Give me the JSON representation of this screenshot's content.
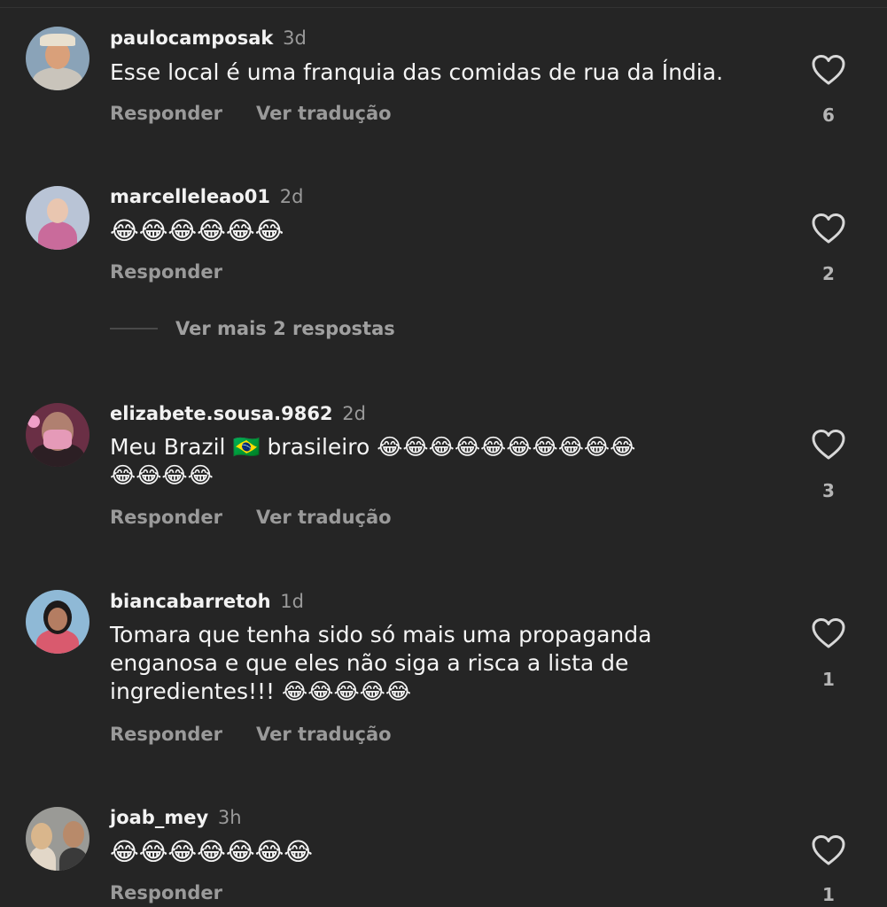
{
  "actions": {
    "reply": "Responder",
    "translate": "Ver tradução"
  },
  "comments": [
    {
      "username": "paulocamposak",
      "time": "3d",
      "text": "Esse local é uma franquia das comidas de rua da Índia.",
      "likes": "6"
    },
    {
      "username": "marcelleleao01",
      "time": "2d",
      "text": "😂😂😂😂😂😂",
      "likes": "2"
    },
    {
      "username": "elizabete.sousa.9862",
      "time": "2d",
      "text_line1": "Meu Brazil 🇧🇷 brasileiro 😂😂😂😂😂😂😂😂😂😂",
      "text_line2": "😂😂😂😂",
      "likes": "3"
    },
    {
      "username": "biancabarretoh",
      "time": "1d",
      "text_line1": "Tomara que tenha sido só mais uma propaganda",
      "text_line2": "enganosa e que eles não siga a risca a lista de",
      "text_line3": "ingredientes!!! 😂😂😂😂😂",
      "likes": "1"
    },
    {
      "username": "joab_mey",
      "time": "3h",
      "text": "😂😂😂😂😂😂😂",
      "likes": "1"
    }
  ],
  "view_more_replies": "Ver mais 2 respostas",
  "colors": {
    "background": "#252525",
    "secondary_text": "#9a9a9a",
    "primary_text": "#f2f2f2"
  }
}
